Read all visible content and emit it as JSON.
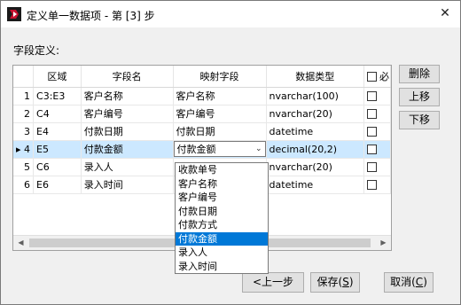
{
  "window": {
    "title": "定义单一数据项 - 第 [3] 步",
    "app_icon": "app-logo-icon",
    "close_glyph": "✕"
  },
  "section_label": "字段定义:",
  "table": {
    "headers": [
      "区域",
      "字段名",
      "映射字段",
      "数据类型",
      "必"
    ],
    "rows": [
      {
        "num": "1",
        "area": "C3:E3",
        "field": "客户名称",
        "mapped": "客户名称",
        "type": "nvarchar(100)"
      },
      {
        "num": "2",
        "area": "C4",
        "field": "客户编号",
        "mapped": "客户编号",
        "type": "nvarchar(20)"
      },
      {
        "num": "3",
        "area": "E4",
        "field": "付款日期",
        "mapped": "付款日期",
        "type": "datetime"
      },
      {
        "num": "4",
        "area": "E5",
        "field": "付款金额",
        "mapped": "付款金额",
        "type": "decimal(20,2)"
      },
      {
        "num": "5",
        "area": "C6",
        "field": "录入人",
        "mapped": "",
        "type": "nvarchar(20)"
      },
      {
        "num": "6",
        "area": "E6",
        "field": "录入时间",
        "mapped": "",
        "type": "datetime"
      }
    ],
    "selected_row_marker": "▸"
  },
  "dropdown": {
    "options": [
      "收款单号",
      "客户名称",
      "客户编号",
      "付款日期",
      "付款方式",
      "付款金额",
      "录入人",
      "录入时间"
    ],
    "selected": "付款金额"
  },
  "side_buttons": {
    "delete": "删除",
    "move_up": "上移",
    "move_down": "下移"
  },
  "footer": {
    "prev": {
      "text": "<上一步"
    },
    "save": {
      "text": "保存(",
      "key": "S",
      "tail": ")"
    },
    "cancel": {
      "text": "取消(",
      "key": "C",
      "tail": ")"
    }
  },
  "colors": {
    "selected_row": "#cce8ff",
    "dropdown_highlight": "#0078d7",
    "logo_red": "#c8102e"
  }
}
